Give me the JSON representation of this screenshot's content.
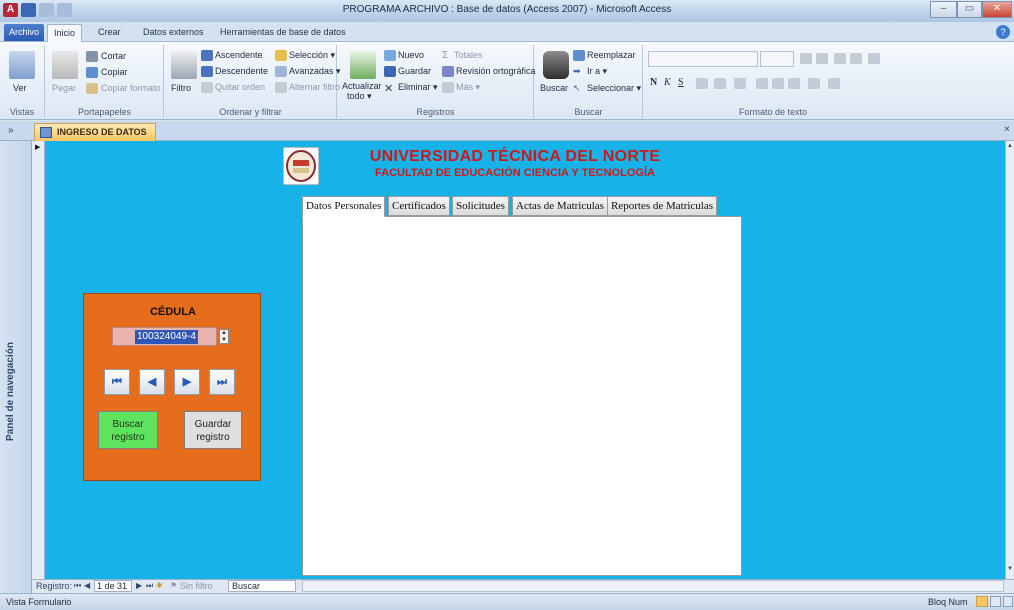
{
  "window": {
    "title": "PROGRAMA ARCHIVO : Base de datos (Access 2007)  -  Microsoft Access",
    "app_letter": "A",
    "min": "–",
    "max": "▭",
    "close": "✕"
  },
  "ribbon_tabs": [
    "Archivo",
    "Inicio",
    "Crear",
    "Datos externos",
    "Herramientas de base de datos"
  ],
  "ribbon": {
    "vistas": {
      "ver": "Ver",
      "label": "Vistas"
    },
    "portapapeles": {
      "pegar": "Pegar",
      "cortar": "Cortar",
      "copiar": "Copiar",
      "copiar_formato": "Copiar formato",
      "label": "Portapapeles"
    },
    "ordenar": {
      "filtro": "Filtro",
      "ascendente": "Ascendente",
      "descendente": "Descendente",
      "quitar_orden": "Quitar orden",
      "seleccion": "Selección ▾",
      "avanzadas": "Avanzadas ▾",
      "alternar_filtro": "Alternar filtro",
      "label": "Ordenar y filtrar"
    },
    "registros": {
      "actualizar": "Actualizar",
      "todo": "todo ▾",
      "nuevo": "Nuevo",
      "guardar": "Guardar",
      "eliminar": "Eliminar ▾",
      "totales": "Totales",
      "revision": "Revisión ortográfica",
      "mas": "Más ▾",
      "label": "Registros"
    },
    "buscar": {
      "buscar": "Buscar",
      "reemplazar": "Reemplazar",
      "ir_a": "Ir a ▾",
      "seleccionar": "Seleccionar ▾",
      "label": "Buscar"
    },
    "formato": {
      "bold": "N",
      "italic": "K",
      "underline": "S",
      "label": "Formato de texto"
    }
  },
  "document_tab": "INGRESO DE DATOS",
  "nav_pane": {
    "label": "Panel de navegación",
    "toggle": "»"
  },
  "form": {
    "university": "UNIVERSIDAD TÉCNICA DEL NORTE",
    "faculty": "FACULTAD DE EDUCACIÓN CIENCIA Y TECNOLOGÍA",
    "tabs": [
      "Datos Personales",
      "Certificados",
      "Solicitudes",
      "Actas de Matriculas",
      "Reportes de Matriculas"
    ],
    "cedula_label": "CÉDULA",
    "cedula_value": "100324049-4",
    "nav_buttons": [
      "⏮",
      "◀",
      "▶",
      "⏭"
    ],
    "search_button": "Buscar registro",
    "save_button": "Guardar registro"
  },
  "record_nav": {
    "label": "Registro:",
    "position": "1 de 31",
    "no_filter": "Sin filtro",
    "search": "Buscar"
  },
  "status": {
    "left": "Vista Formulario",
    "right": "Bloq Num"
  },
  "colors": {
    "form_bg": "#17b2e8",
    "box_bg": "#e56d1b",
    "title_red": "#cc1a1a",
    "search_btn": "#5ee35e"
  }
}
